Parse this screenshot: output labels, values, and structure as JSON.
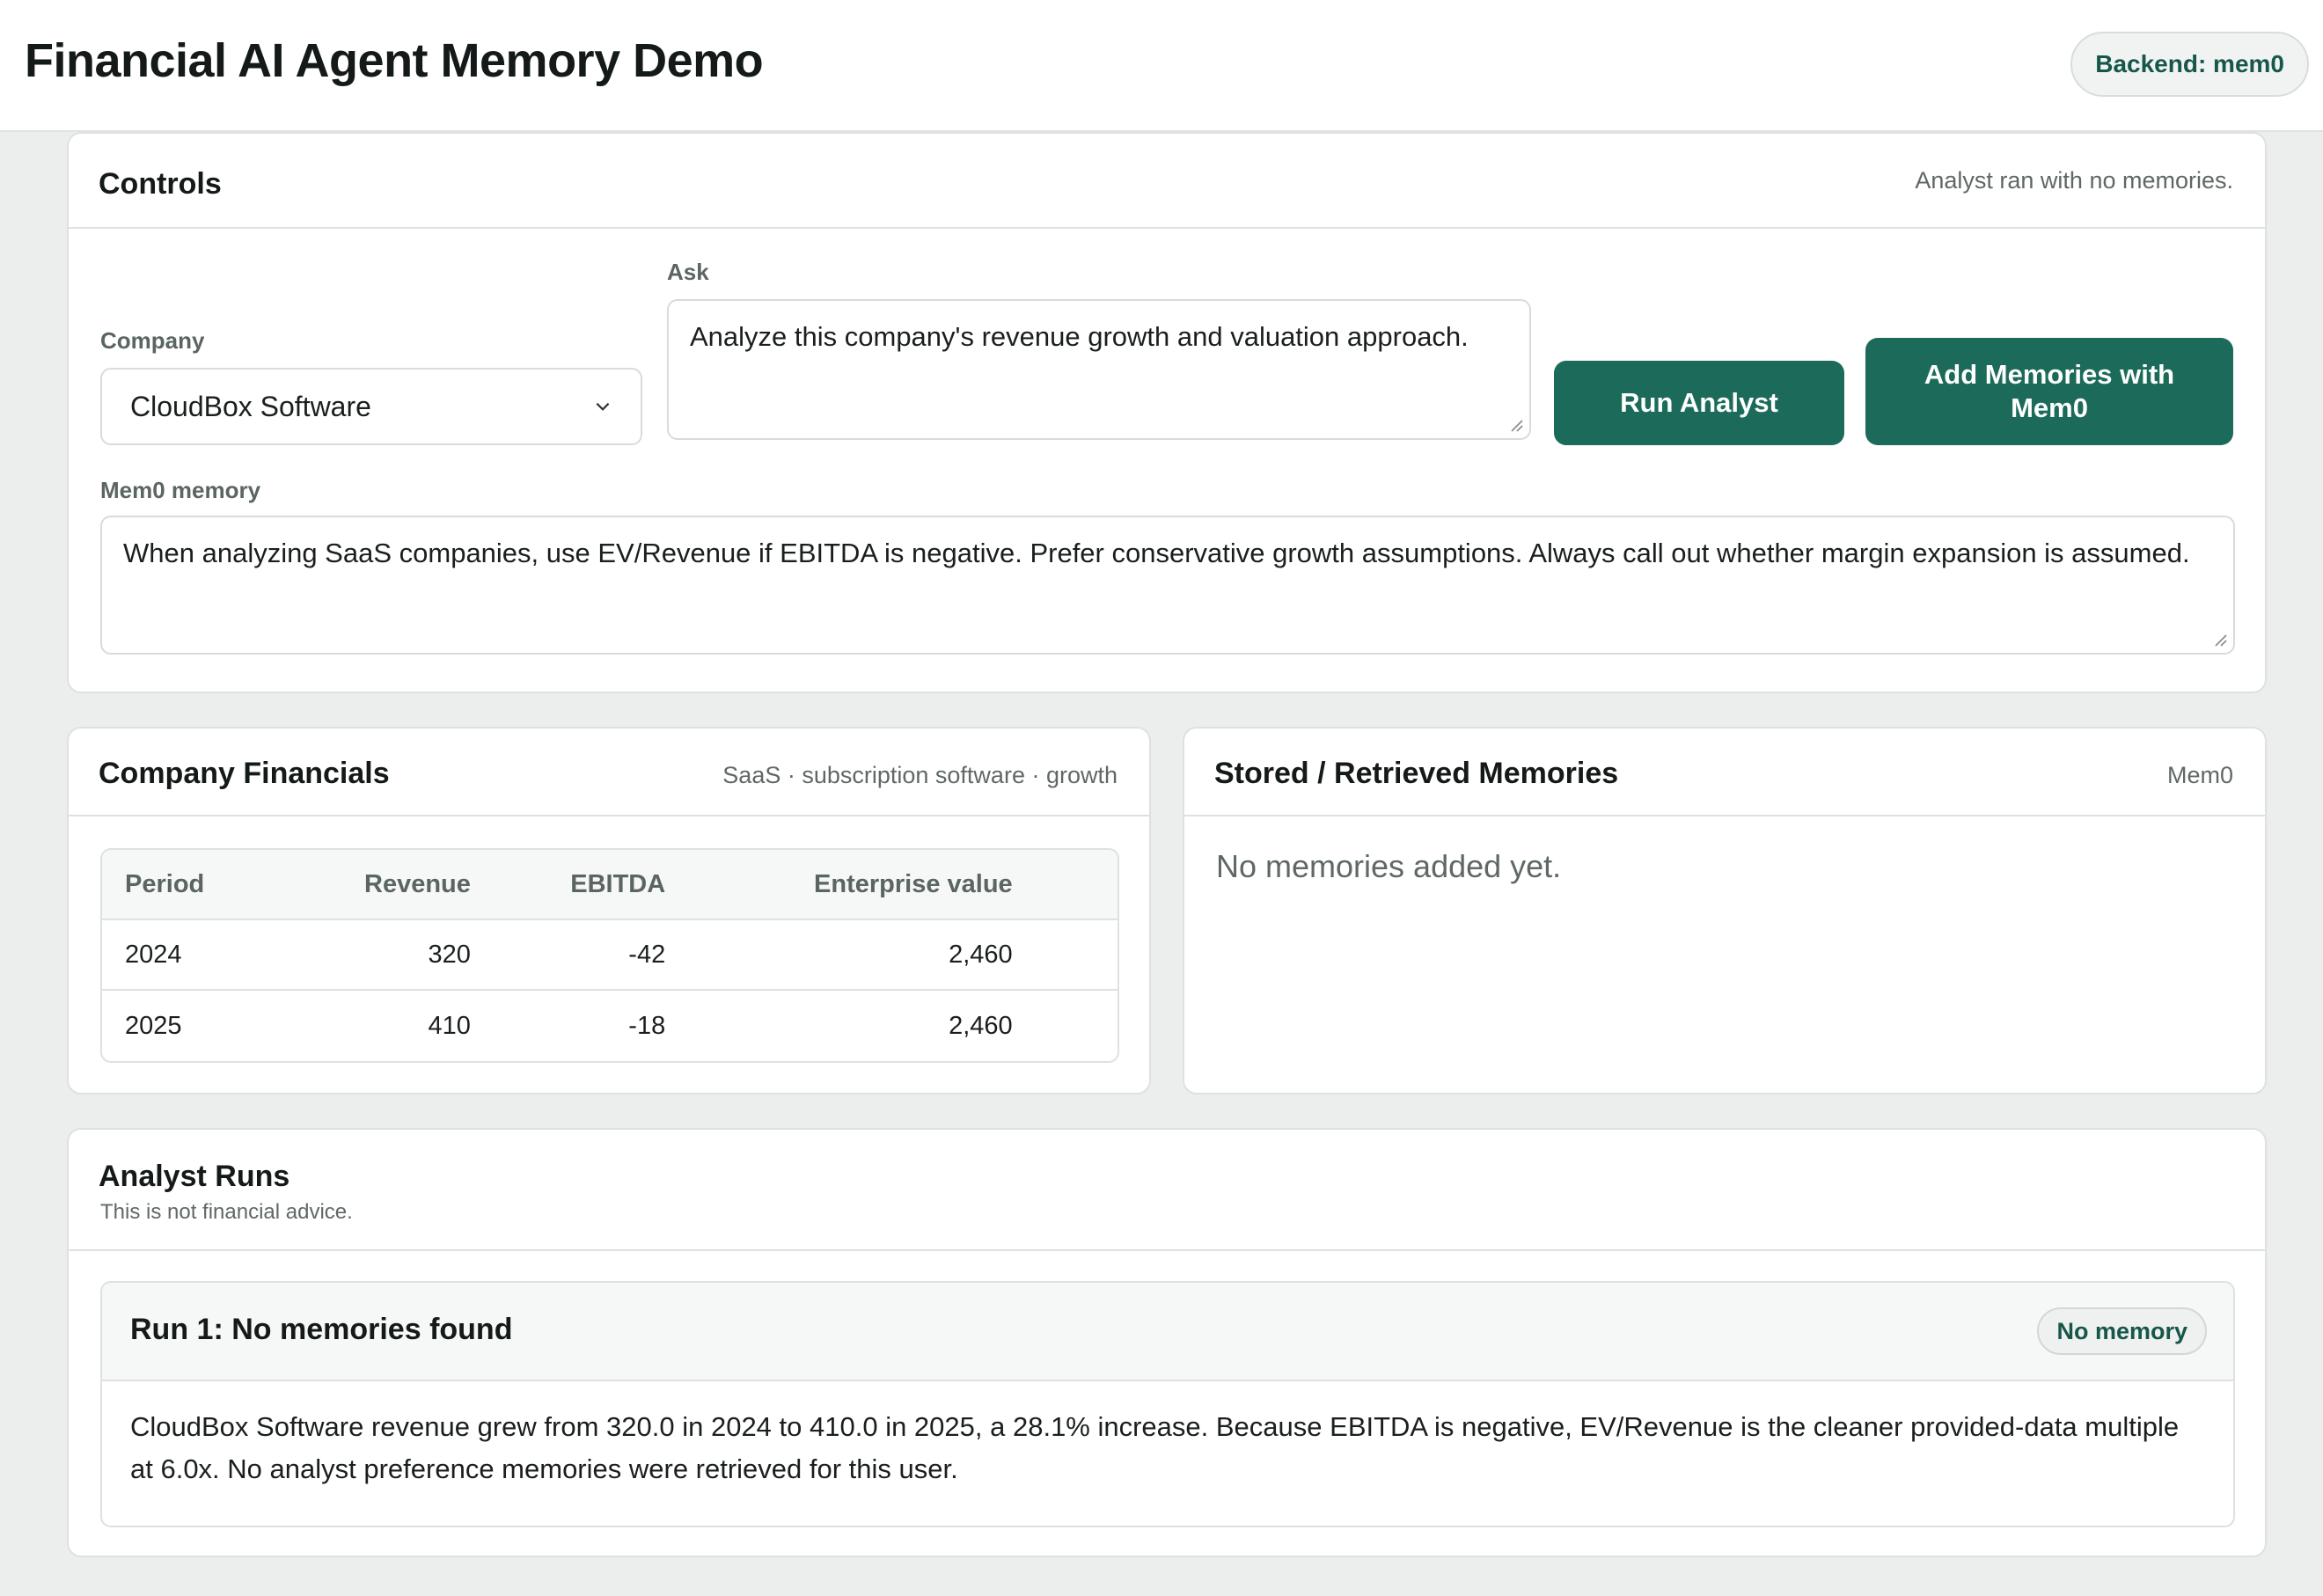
{
  "header": {
    "title": "Financial AI Agent Memory Demo",
    "backend_badge": "Backend: mem0"
  },
  "controls": {
    "title": "Controls",
    "status": "Analyst ran with no memories.",
    "company_label": "Company",
    "company_value": "CloudBox Software",
    "ask_label": "Ask",
    "ask_value": "Analyze this company's revenue growth and valuation approach.",
    "memory_label": "Mem0 memory",
    "memory_value": "When analyzing SaaS companies, use EV/Revenue if EBITDA is negative. Prefer conservative growth assumptions. Always call out whether margin expansion is assumed.",
    "run_button": "Run Analyst",
    "add_button": "Add Memories with Mem0"
  },
  "financials": {
    "title": "Company Financials",
    "meta": "SaaS · subscription software · growth",
    "columns": [
      "Period",
      "Revenue",
      "EBITDA",
      "Enterprise value"
    ],
    "rows": [
      [
        "2024",
        "320",
        "-42",
        "2,460"
      ],
      [
        "2025",
        "410",
        "-18",
        "2,460"
      ]
    ]
  },
  "memories": {
    "title": "Stored / Retrieved Memories",
    "meta": "Mem0",
    "empty": "No memories added yet."
  },
  "runs": {
    "title": "Analyst Runs",
    "subtitle": "This is not financial advice.",
    "items": [
      {
        "title": "Run 1: No memories found",
        "badge": "No memory",
        "text": "CloudBox Software revenue grew from 320.0 in 2024 to 410.0 in 2025, a 28.1% increase. Because EBITDA is negative, EV/Revenue is the cleaner provided-data multiple at 6.0x. No analyst preference memories were retrieved for this user."
      }
    ]
  },
  "colors": {
    "accent": "#1c6b5a",
    "accent_text": "#17574a",
    "page_bg": "#eceeee",
    "border": "#dde1e0"
  }
}
